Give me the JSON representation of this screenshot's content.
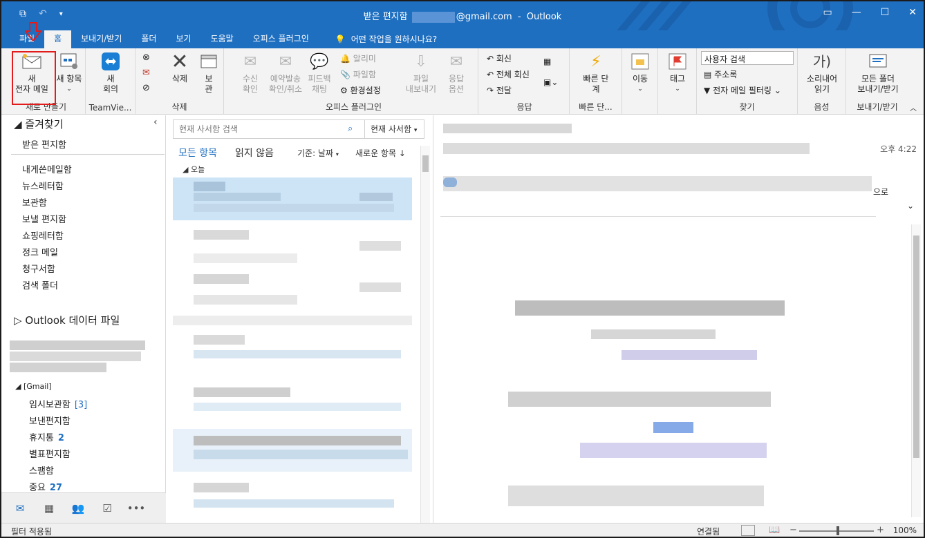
{
  "titlebar": {
    "title_left": "받은 편지함",
    "title_email": "@gmail.com",
    "title_sep": "-",
    "app": "Outlook",
    "icons": [
      "outlook-icon",
      "undo-icon",
      "qat-customize-icon",
      "ribbon-display-icon",
      "minimize-icon",
      "restore-icon",
      "close-icon"
    ]
  },
  "tabs": {
    "file": "파일",
    "home": "홈",
    "send_receive": "보내기/받기",
    "folder": "폴더",
    "view": "보기",
    "help": "도움말",
    "office_plugin": "오피스 플러그인",
    "tell_me": "어떤 작업을 원하시나요?"
  },
  "ribbon": {
    "new_group": {
      "new_mail": [
        "새",
        "전자 메일"
      ],
      "new_items": "새 항목",
      "label": "새로 만들기"
    },
    "teamviewer": {
      "new_meeting": [
        "새",
        "회의"
      ],
      "label": "TeamVie..."
    },
    "delete_group": {
      "delete": "삭제",
      "archive": [
        "보",
        "관"
      ],
      "label": "삭제"
    },
    "plugin_group": {
      "receipt": [
        "수신",
        "확인"
      ],
      "schedule": [
        "예약발송",
        "확인/취소"
      ],
      "feedback": [
        "피드백",
        "채팅"
      ],
      "notify": "알리미",
      "attach": "파일함",
      "settings": "환경설정",
      "file_send": [
        "파일",
        "내보내기"
      ],
      "reply_options": [
        "응답",
        "옵션"
      ],
      "label": "오피스 플러그인"
    },
    "respond_group": {
      "reply": "회신",
      "reply_all": "전체 회신",
      "forward": "전달",
      "label": "응답"
    },
    "quick_group": {
      "quick_steps": [
        "빠른 단",
        "계"
      ],
      "label": "빠른 단..."
    },
    "move_group": {
      "move": "이동"
    },
    "tags_group": {
      "tags": "태그"
    },
    "find_group": {
      "search_people": "사용자 검색",
      "address_book": "주소록",
      "filter_email": "전자 메일 필터링",
      "label": "찾기"
    },
    "speech_group": {
      "read_aloud": [
        "소리내어",
        "읽기"
      ],
      "label": "음성"
    },
    "sendall_group": {
      "send_all": [
        "모든 폴더",
        "보내기/받기"
      ],
      "label": "보내기/받기"
    }
  },
  "folders": {
    "favorites": "즐겨찾기",
    "inbox": "받은 편지함",
    "items": [
      "내게쓴메일함",
      "뉴스레터함",
      "보관함",
      "보낼 편지함",
      "쇼핑레터함",
      "정크 메일",
      "청구서함",
      "검색 폴더"
    ],
    "data_file": "Outlook 데이터 파일",
    "gmail": "[Gmail]",
    "gmail_items": [
      {
        "label": "임시보관함",
        "count": "[3]"
      },
      {
        "label": "보낸편지함",
        "count": ""
      },
      {
        "label": "휴지통",
        "count": "2"
      },
      {
        "label": "별표편지함",
        "count": ""
      },
      {
        "label": "스팸함",
        "count": ""
      },
      {
        "label": "중요",
        "count": "27"
      }
    ]
  },
  "list": {
    "search_placeholder": "현재 사서함 검색",
    "scope": "현재 사서함",
    "all": "모든 항목",
    "unread": "읽지 않음",
    "sort": "기준: 날짜",
    "order": "새로운 항목",
    "group_today": "오늘"
  },
  "reading": {
    "time": "오후 4:22",
    "trail": "으로"
  },
  "status": {
    "filter": "필터 적용됨",
    "connected": "연결됨",
    "zoom": "100%"
  },
  "colors": {
    "accent": "#1f6fc1",
    "highlight": "#e31b1b",
    "selected_row": "#cde4f7"
  }
}
